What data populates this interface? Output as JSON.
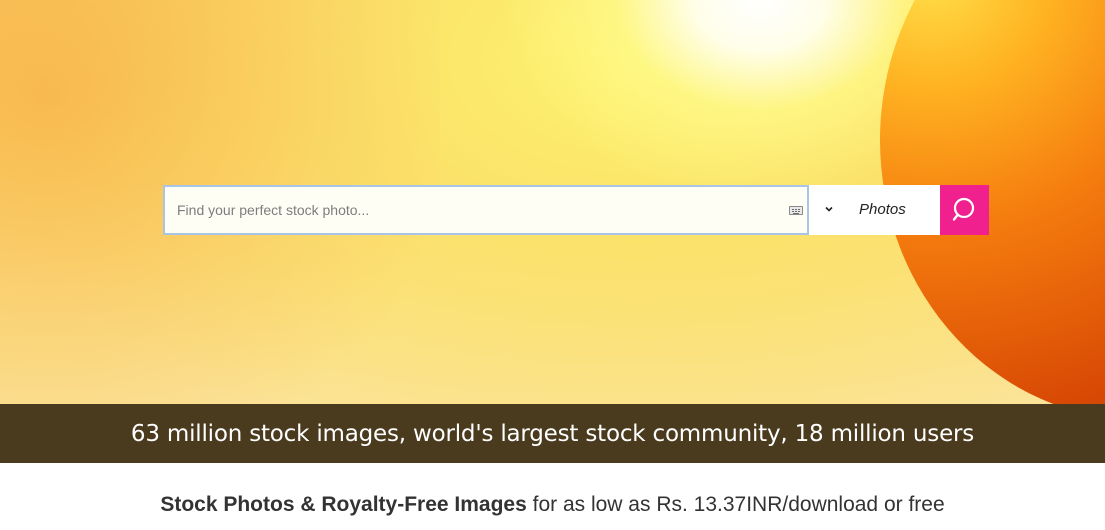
{
  "search": {
    "placeholder": "Find your perfect stock photo...",
    "value": "",
    "type_selected": "Photos",
    "keyboard_icon": "keyboard-icon",
    "dropdown_icon": "chevron-down-icon",
    "button_icon": "search-icon",
    "button_color": "#f0208f"
  },
  "stats": {
    "text": "63 million stock images, world's largest stock community, 18 million users"
  },
  "tagline": {
    "bold": "Stock Photos & Royalty-Free Images",
    "rest": "for as low as Rs. 13.37INR/download or free"
  }
}
